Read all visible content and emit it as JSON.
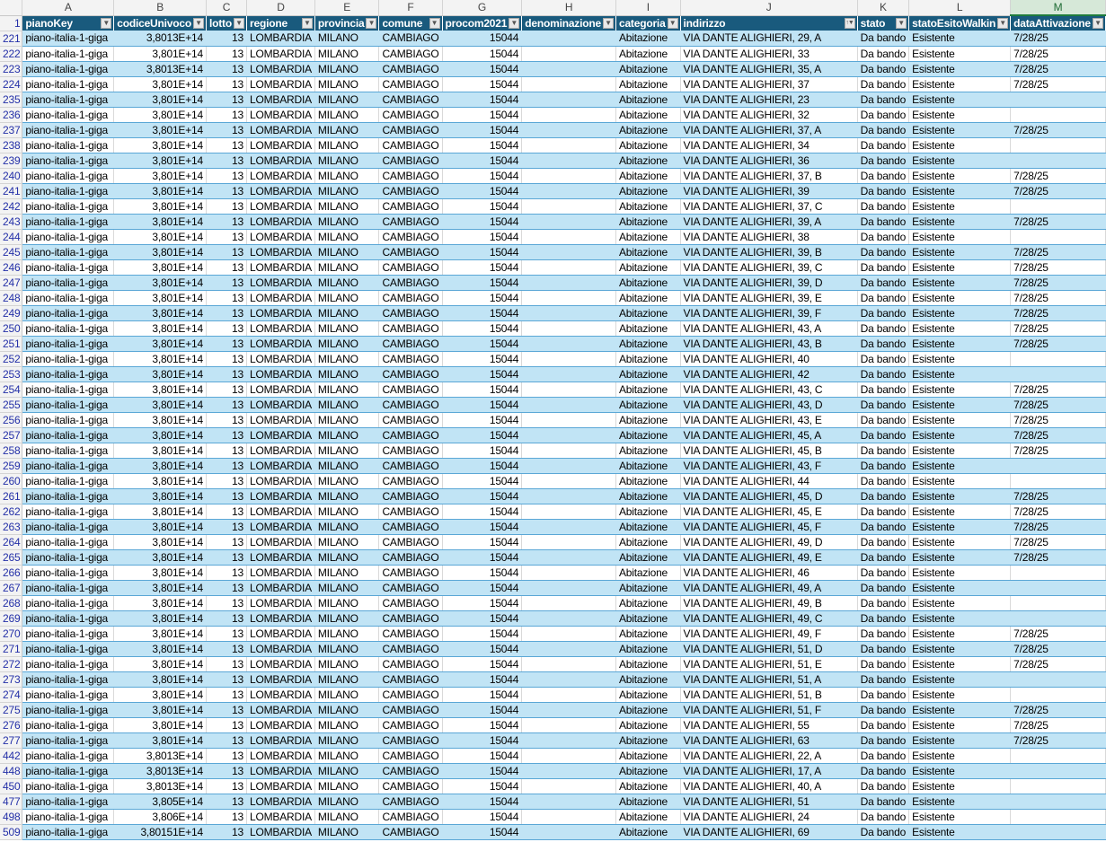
{
  "columns": [
    "A",
    "B",
    "C",
    "D",
    "E",
    "F",
    "G",
    "H",
    "I",
    "J",
    "K",
    "L",
    "M"
  ],
  "selected_column": "M",
  "header_row_number": "1",
  "headers": [
    "pianoKey",
    "codiceUnivoco",
    "lotto",
    "regione",
    "provincia",
    "comune",
    "procom2021",
    "denominazione",
    "categoria",
    "indirizzo",
    "stato",
    "statoEsitoWalkin",
    "dataAttivazione"
  ],
  "filter_icons": [
    "dropdown",
    "dropdown",
    "dropdown",
    "dropdown",
    "dropdown",
    "dropdown",
    "dropdown",
    "dropdown",
    "dropdown",
    "sort-filter-active",
    "dropdown",
    "dropdown",
    "dropdown"
  ],
  "colors": {
    "header_fill": "#195a7d",
    "band_fill": "#c1e4f5",
    "row_border": "#5aa7d6",
    "row_number_text": "#2430a8"
  },
  "rows": [
    {
      "n": "221",
      "cells": [
        "piano-italia-1-giga",
        "3,8013E+14",
        "13",
        "LOMBARDIA",
        "MILANO",
        "CAMBIAGO",
        "15044",
        "",
        "Abitazione",
        "VIA DANTE ALIGHIERI, 29, A",
        "Da bando",
        "Esistente",
        "7/28/25"
      ]
    },
    {
      "n": "222",
      "cells": [
        "piano-italia-1-giga",
        "3,801E+14",
        "13",
        "LOMBARDIA",
        "MILANO",
        "CAMBIAGO",
        "15044",
        "",
        "Abitazione",
        "VIA DANTE ALIGHIERI, 33",
        "Da bando",
        "Esistente",
        "7/28/25"
      ]
    },
    {
      "n": "223",
      "cells": [
        "piano-italia-1-giga",
        "3,8013E+14",
        "13",
        "LOMBARDIA",
        "MILANO",
        "CAMBIAGO",
        "15044",
        "",
        "Abitazione",
        "VIA DANTE ALIGHIERI, 35, A",
        "Da bando",
        "Esistente",
        "7/28/25"
      ]
    },
    {
      "n": "224",
      "cells": [
        "piano-italia-1-giga",
        "3,801E+14",
        "13",
        "LOMBARDIA",
        "MILANO",
        "CAMBIAGO",
        "15044",
        "",
        "Abitazione",
        "VIA DANTE ALIGHIERI, 37",
        "Da bando",
        "Esistente",
        "7/28/25"
      ]
    },
    {
      "n": "235",
      "cells": [
        "piano-italia-1-giga",
        "3,801E+14",
        "13",
        "LOMBARDIA",
        "MILANO",
        "CAMBIAGO",
        "15044",
        "",
        "Abitazione",
        "VIA DANTE ALIGHIERI, 23",
        "Da bando",
        "Esistente",
        ""
      ]
    },
    {
      "n": "236",
      "cells": [
        "piano-italia-1-giga",
        "3,801E+14",
        "13",
        "LOMBARDIA",
        "MILANO",
        "CAMBIAGO",
        "15044",
        "",
        "Abitazione",
        "VIA DANTE ALIGHIERI, 32",
        "Da bando",
        "Esistente",
        ""
      ]
    },
    {
      "n": "237",
      "cells": [
        "piano-italia-1-giga",
        "3,801E+14",
        "13",
        "LOMBARDIA",
        "MILANO",
        "CAMBIAGO",
        "15044",
        "",
        "Abitazione",
        "VIA DANTE ALIGHIERI, 37, A",
        "Da bando",
        "Esistente",
        "7/28/25"
      ]
    },
    {
      "n": "238",
      "cells": [
        "piano-italia-1-giga",
        "3,801E+14",
        "13",
        "LOMBARDIA",
        "MILANO",
        "CAMBIAGO",
        "15044",
        "",
        "Abitazione",
        "VIA DANTE ALIGHIERI, 34",
        "Da bando",
        "Esistente",
        ""
      ]
    },
    {
      "n": "239",
      "cells": [
        "piano-italia-1-giga",
        "3,801E+14",
        "13",
        "LOMBARDIA",
        "MILANO",
        "CAMBIAGO",
        "15044",
        "",
        "Abitazione",
        "VIA DANTE ALIGHIERI, 36",
        "Da bando",
        "Esistente",
        ""
      ]
    },
    {
      "n": "240",
      "cells": [
        "piano-italia-1-giga",
        "3,801E+14",
        "13",
        "LOMBARDIA",
        "MILANO",
        "CAMBIAGO",
        "15044",
        "",
        "Abitazione",
        "VIA DANTE ALIGHIERI, 37, B",
        "Da bando",
        "Esistente",
        "7/28/25"
      ]
    },
    {
      "n": "241",
      "cells": [
        "piano-italia-1-giga",
        "3,801E+14",
        "13",
        "LOMBARDIA",
        "MILANO",
        "CAMBIAGO",
        "15044",
        "",
        "Abitazione",
        "VIA DANTE ALIGHIERI, 39",
        "Da bando",
        "Esistente",
        "7/28/25"
      ]
    },
    {
      "n": "242",
      "cells": [
        "piano-italia-1-giga",
        "3,801E+14",
        "13",
        "LOMBARDIA",
        "MILANO",
        "CAMBIAGO",
        "15044",
        "",
        "Abitazione",
        "VIA DANTE ALIGHIERI, 37, C",
        "Da bando",
        "Esistente",
        ""
      ]
    },
    {
      "n": "243",
      "cells": [
        "piano-italia-1-giga",
        "3,801E+14",
        "13",
        "LOMBARDIA",
        "MILANO",
        "CAMBIAGO",
        "15044",
        "",
        "Abitazione",
        "VIA DANTE ALIGHIERI, 39, A",
        "Da bando",
        "Esistente",
        "7/28/25"
      ]
    },
    {
      "n": "244",
      "cells": [
        "piano-italia-1-giga",
        "3,801E+14",
        "13",
        "LOMBARDIA",
        "MILANO",
        "CAMBIAGO",
        "15044",
        "",
        "Abitazione",
        "VIA DANTE ALIGHIERI, 38",
        "Da bando",
        "Esistente",
        ""
      ]
    },
    {
      "n": "245",
      "cells": [
        "piano-italia-1-giga",
        "3,801E+14",
        "13",
        "LOMBARDIA",
        "MILANO",
        "CAMBIAGO",
        "15044",
        "",
        "Abitazione",
        "VIA DANTE ALIGHIERI, 39, B",
        "Da bando",
        "Esistente",
        "7/28/25"
      ]
    },
    {
      "n": "246",
      "cells": [
        "piano-italia-1-giga",
        "3,801E+14",
        "13",
        "LOMBARDIA",
        "MILANO",
        "CAMBIAGO",
        "15044",
        "",
        "Abitazione",
        "VIA DANTE ALIGHIERI, 39, C",
        "Da bando",
        "Esistente",
        "7/28/25"
      ]
    },
    {
      "n": "247",
      "cells": [
        "piano-italia-1-giga",
        "3,801E+14",
        "13",
        "LOMBARDIA",
        "MILANO",
        "CAMBIAGO",
        "15044",
        "",
        "Abitazione",
        "VIA DANTE ALIGHIERI, 39, D",
        "Da bando",
        "Esistente",
        "7/28/25"
      ]
    },
    {
      "n": "248",
      "cells": [
        "piano-italia-1-giga",
        "3,801E+14",
        "13",
        "LOMBARDIA",
        "MILANO",
        "CAMBIAGO",
        "15044",
        "",
        "Abitazione",
        "VIA DANTE ALIGHIERI, 39, E",
        "Da bando",
        "Esistente",
        "7/28/25"
      ]
    },
    {
      "n": "249",
      "cells": [
        "piano-italia-1-giga",
        "3,801E+14",
        "13",
        "LOMBARDIA",
        "MILANO",
        "CAMBIAGO",
        "15044",
        "",
        "Abitazione",
        "VIA DANTE ALIGHIERI, 39, F",
        "Da bando",
        "Esistente",
        "7/28/25"
      ]
    },
    {
      "n": "250",
      "cells": [
        "piano-italia-1-giga",
        "3,801E+14",
        "13",
        "LOMBARDIA",
        "MILANO",
        "CAMBIAGO",
        "15044",
        "",
        "Abitazione",
        "VIA DANTE ALIGHIERI, 43, A",
        "Da bando",
        "Esistente",
        "7/28/25"
      ]
    },
    {
      "n": "251",
      "cells": [
        "piano-italia-1-giga",
        "3,801E+14",
        "13",
        "LOMBARDIA",
        "MILANO",
        "CAMBIAGO",
        "15044",
        "",
        "Abitazione",
        "VIA DANTE ALIGHIERI, 43, B",
        "Da bando",
        "Esistente",
        "7/28/25"
      ]
    },
    {
      "n": "252",
      "cells": [
        "piano-italia-1-giga",
        "3,801E+14",
        "13",
        "LOMBARDIA",
        "MILANO",
        "CAMBIAGO",
        "15044",
        "",
        "Abitazione",
        "VIA DANTE ALIGHIERI, 40",
        "Da bando",
        "Esistente",
        ""
      ]
    },
    {
      "n": "253",
      "cells": [
        "piano-italia-1-giga",
        "3,801E+14",
        "13",
        "LOMBARDIA",
        "MILANO",
        "CAMBIAGO",
        "15044",
        "",
        "Abitazione",
        "VIA DANTE ALIGHIERI, 42",
        "Da bando",
        "Esistente",
        ""
      ]
    },
    {
      "n": "254",
      "cells": [
        "piano-italia-1-giga",
        "3,801E+14",
        "13",
        "LOMBARDIA",
        "MILANO",
        "CAMBIAGO",
        "15044",
        "",
        "Abitazione",
        "VIA DANTE ALIGHIERI, 43, C",
        "Da bando",
        "Esistente",
        "7/28/25"
      ]
    },
    {
      "n": "255",
      "cells": [
        "piano-italia-1-giga",
        "3,801E+14",
        "13",
        "LOMBARDIA",
        "MILANO",
        "CAMBIAGO",
        "15044",
        "",
        "Abitazione",
        "VIA DANTE ALIGHIERI, 43, D",
        "Da bando",
        "Esistente",
        "7/28/25"
      ]
    },
    {
      "n": "256",
      "cells": [
        "piano-italia-1-giga",
        "3,801E+14",
        "13",
        "LOMBARDIA",
        "MILANO",
        "CAMBIAGO",
        "15044",
        "",
        "Abitazione",
        "VIA DANTE ALIGHIERI, 43, E",
        "Da bando",
        "Esistente",
        "7/28/25"
      ]
    },
    {
      "n": "257",
      "cells": [
        "piano-italia-1-giga",
        "3,801E+14",
        "13",
        "LOMBARDIA",
        "MILANO",
        "CAMBIAGO",
        "15044",
        "",
        "Abitazione",
        "VIA DANTE ALIGHIERI, 45, A",
        "Da bando",
        "Esistente",
        "7/28/25"
      ]
    },
    {
      "n": "258",
      "cells": [
        "piano-italia-1-giga",
        "3,801E+14",
        "13",
        "LOMBARDIA",
        "MILANO",
        "CAMBIAGO",
        "15044",
        "",
        "Abitazione",
        "VIA DANTE ALIGHIERI, 45, B",
        "Da bando",
        "Esistente",
        "7/28/25"
      ]
    },
    {
      "n": "259",
      "cells": [
        "piano-italia-1-giga",
        "3,801E+14",
        "13",
        "LOMBARDIA",
        "MILANO",
        "CAMBIAGO",
        "15044",
        "",
        "Abitazione",
        "VIA DANTE ALIGHIERI, 43, F",
        "Da bando",
        "Esistente",
        ""
      ]
    },
    {
      "n": "260",
      "cells": [
        "piano-italia-1-giga",
        "3,801E+14",
        "13",
        "LOMBARDIA",
        "MILANO",
        "CAMBIAGO",
        "15044",
        "",
        "Abitazione",
        "VIA DANTE ALIGHIERI, 44",
        "Da bando",
        "Esistente",
        ""
      ]
    },
    {
      "n": "261",
      "cells": [
        "piano-italia-1-giga",
        "3,801E+14",
        "13",
        "LOMBARDIA",
        "MILANO",
        "CAMBIAGO",
        "15044",
        "",
        "Abitazione",
        "VIA DANTE ALIGHIERI, 45, D",
        "Da bando",
        "Esistente",
        "7/28/25"
      ]
    },
    {
      "n": "262",
      "cells": [
        "piano-italia-1-giga",
        "3,801E+14",
        "13",
        "LOMBARDIA",
        "MILANO",
        "CAMBIAGO",
        "15044",
        "",
        "Abitazione",
        "VIA DANTE ALIGHIERI, 45, E",
        "Da bando",
        "Esistente",
        "7/28/25"
      ]
    },
    {
      "n": "263",
      "cells": [
        "piano-italia-1-giga",
        "3,801E+14",
        "13",
        "LOMBARDIA",
        "MILANO",
        "CAMBIAGO",
        "15044",
        "",
        "Abitazione",
        "VIA DANTE ALIGHIERI, 45, F",
        "Da bando",
        "Esistente",
        "7/28/25"
      ]
    },
    {
      "n": "264",
      "cells": [
        "piano-italia-1-giga",
        "3,801E+14",
        "13",
        "LOMBARDIA",
        "MILANO",
        "CAMBIAGO",
        "15044",
        "",
        "Abitazione",
        "VIA DANTE ALIGHIERI, 49, D",
        "Da bando",
        "Esistente",
        "7/28/25"
      ]
    },
    {
      "n": "265",
      "cells": [
        "piano-italia-1-giga",
        "3,801E+14",
        "13",
        "LOMBARDIA",
        "MILANO",
        "CAMBIAGO",
        "15044",
        "",
        "Abitazione",
        "VIA DANTE ALIGHIERI, 49, E",
        "Da bando",
        "Esistente",
        "7/28/25"
      ]
    },
    {
      "n": "266",
      "cells": [
        "piano-italia-1-giga",
        "3,801E+14",
        "13",
        "LOMBARDIA",
        "MILANO",
        "CAMBIAGO",
        "15044",
        "",
        "Abitazione",
        "VIA DANTE ALIGHIERI, 46",
        "Da bando",
        "Esistente",
        ""
      ]
    },
    {
      "n": "267",
      "cells": [
        "piano-italia-1-giga",
        "3,801E+14",
        "13",
        "LOMBARDIA",
        "MILANO",
        "CAMBIAGO",
        "15044",
        "",
        "Abitazione",
        "VIA DANTE ALIGHIERI, 49, A",
        "Da bando",
        "Esistente",
        ""
      ]
    },
    {
      "n": "268",
      "cells": [
        "piano-italia-1-giga",
        "3,801E+14",
        "13",
        "LOMBARDIA",
        "MILANO",
        "CAMBIAGO",
        "15044",
        "",
        "Abitazione",
        "VIA DANTE ALIGHIERI, 49, B",
        "Da bando",
        "Esistente",
        ""
      ]
    },
    {
      "n": "269",
      "cells": [
        "piano-italia-1-giga",
        "3,801E+14",
        "13",
        "LOMBARDIA",
        "MILANO",
        "CAMBIAGO",
        "15044",
        "",
        "Abitazione",
        "VIA DANTE ALIGHIERI, 49, C",
        "Da bando",
        "Esistente",
        ""
      ]
    },
    {
      "n": "270",
      "cells": [
        "piano-italia-1-giga",
        "3,801E+14",
        "13",
        "LOMBARDIA",
        "MILANO",
        "CAMBIAGO",
        "15044",
        "",
        "Abitazione",
        "VIA DANTE ALIGHIERI, 49, F",
        "Da bando",
        "Esistente",
        "7/28/25"
      ]
    },
    {
      "n": "271",
      "cells": [
        "piano-italia-1-giga",
        "3,801E+14",
        "13",
        "LOMBARDIA",
        "MILANO",
        "CAMBIAGO",
        "15044",
        "",
        "Abitazione",
        "VIA DANTE ALIGHIERI, 51, D",
        "Da bando",
        "Esistente",
        "7/28/25"
      ]
    },
    {
      "n": "272",
      "cells": [
        "piano-italia-1-giga",
        "3,801E+14",
        "13",
        "LOMBARDIA",
        "MILANO",
        "CAMBIAGO",
        "15044",
        "",
        "Abitazione",
        "VIA DANTE ALIGHIERI, 51, E",
        "Da bando",
        "Esistente",
        "7/28/25"
      ]
    },
    {
      "n": "273",
      "cells": [
        "piano-italia-1-giga",
        "3,801E+14",
        "13",
        "LOMBARDIA",
        "MILANO",
        "CAMBIAGO",
        "15044",
        "",
        "Abitazione",
        "VIA DANTE ALIGHIERI, 51, A",
        "Da bando",
        "Esistente",
        ""
      ]
    },
    {
      "n": "274",
      "cells": [
        "piano-italia-1-giga",
        "3,801E+14",
        "13",
        "LOMBARDIA",
        "MILANO",
        "CAMBIAGO",
        "15044",
        "",
        "Abitazione",
        "VIA DANTE ALIGHIERI, 51, B",
        "Da bando",
        "Esistente",
        ""
      ]
    },
    {
      "n": "275",
      "cells": [
        "piano-italia-1-giga",
        "3,801E+14",
        "13",
        "LOMBARDIA",
        "MILANO",
        "CAMBIAGO",
        "15044",
        "",
        "Abitazione",
        "VIA DANTE ALIGHIERI, 51, F",
        "Da bando",
        "Esistente",
        "7/28/25"
      ]
    },
    {
      "n": "276",
      "cells": [
        "piano-italia-1-giga",
        "3,801E+14",
        "13",
        "LOMBARDIA",
        "MILANO",
        "CAMBIAGO",
        "15044",
        "",
        "Abitazione",
        "VIA DANTE ALIGHIERI, 55",
        "Da bando",
        "Esistente",
        "7/28/25"
      ]
    },
    {
      "n": "277",
      "cells": [
        "piano-italia-1-giga",
        "3,801E+14",
        "13",
        "LOMBARDIA",
        "MILANO",
        "CAMBIAGO",
        "15044",
        "",
        "Abitazione",
        "VIA DANTE ALIGHIERI, 63",
        "Da bando",
        "Esistente",
        "7/28/25"
      ]
    },
    {
      "n": "442",
      "cells": [
        "piano-italia-1-giga",
        "3,8013E+14",
        "13",
        "LOMBARDIA",
        "MILANO",
        "CAMBIAGO",
        "15044",
        "",
        "Abitazione",
        "VIA DANTE ALIGHIERI, 22, A",
        "Da bando",
        "Esistente",
        ""
      ]
    },
    {
      "n": "448",
      "cells": [
        "piano-italia-1-giga",
        "3,8013E+14",
        "13",
        "LOMBARDIA",
        "MILANO",
        "CAMBIAGO",
        "15044",
        "",
        "Abitazione",
        "VIA DANTE ALIGHIERI, 17, A",
        "Da bando",
        "Esistente",
        ""
      ]
    },
    {
      "n": "450",
      "cells": [
        "piano-italia-1-giga",
        "3,8013E+14",
        "13",
        "LOMBARDIA",
        "MILANO",
        "CAMBIAGO",
        "15044",
        "",
        "Abitazione",
        "VIA DANTE ALIGHIERI, 40, A",
        "Da bando",
        "Esistente",
        ""
      ]
    },
    {
      "n": "477",
      "cells": [
        "piano-italia-1-giga",
        "3,805E+14",
        "13",
        "LOMBARDIA",
        "MILANO",
        "CAMBIAGO",
        "15044",
        "",
        "Abitazione",
        "VIA DANTE ALIGHIERI, 51",
        "Da bando",
        "Esistente",
        ""
      ]
    },
    {
      "n": "498",
      "cells": [
        "piano-italia-1-giga",
        "3,806E+14",
        "13",
        "LOMBARDIA",
        "MILANO",
        "CAMBIAGO",
        "15044",
        "",
        "Abitazione",
        "VIA DANTE ALIGHIERI, 24",
        "Da bando",
        "Esistente",
        ""
      ]
    },
    {
      "n": "509",
      "cells": [
        "piano-italia-1-giga",
        "3,80151E+14",
        "13",
        "LOMBARDIA",
        "MILANO",
        "CAMBIAGO",
        "15044",
        "",
        "Abitazione",
        "VIA DANTE ALIGHIERI, 69",
        "Da bando",
        "Esistente",
        ""
      ]
    }
  ]
}
